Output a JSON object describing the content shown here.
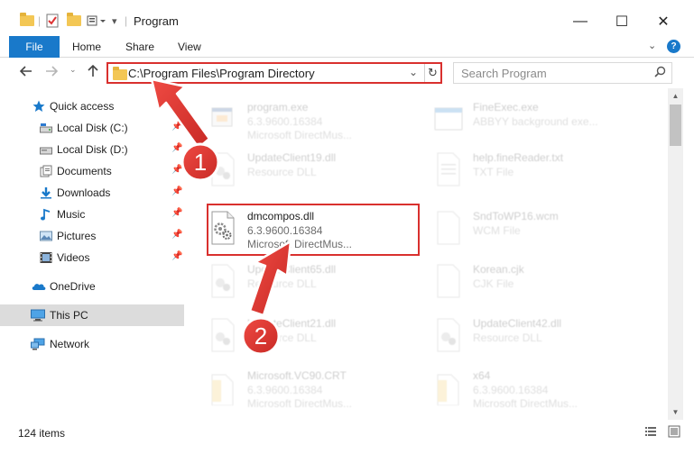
{
  "window": {
    "title": "Program",
    "minimize": "—",
    "maximize": "☐",
    "close": "✕"
  },
  "ribbon": {
    "tabs": [
      "File",
      "Home",
      "Share",
      "View"
    ],
    "help": "?"
  },
  "address": {
    "path": "C:\\Program Files\\Program Directory",
    "search_placeholder": "Search Program"
  },
  "sidebar": {
    "items": [
      {
        "label": "Quick access",
        "icon": "star-icon",
        "pinned": false
      },
      {
        "label": "Local Disk (C:)",
        "icon": "drive-icon",
        "pinned": true
      },
      {
        "label": "Local Disk (D:)",
        "icon": "drive-icon",
        "pinned": true
      },
      {
        "label": "Documents",
        "icon": "documents-icon",
        "pinned": true
      },
      {
        "label": "Downloads",
        "icon": "download-icon",
        "pinned": true
      },
      {
        "label": "Music",
        "icon": "music-icon",
        "pinned": true
      },
      {
        "label": "Pictures",
        "icon": "pictures-icon",
        "pinned": true
      },
      {
        "label": "Videos",
        "icon": "videos-icon",
        "pinned": true
      },
      {
        "label": "OneDrive",
        "icon": "cloud-icon",
        "pinned": false
      },
      {
        "label": "This PC",
        "icon": "computer-icon",
        "pinned": false,
        "selected": true
      },
      {
        "label": "Network",
        "icon": "network-icon",
        "pinned": false
      }
    ]
  },
  "files": {
    "left": [
      {
        "name": "program.exe",
        "line2": "6.3.9600.16384",
        "line3": "Microsoft DirectMus...",
        "icon": "exe-icon",
        "faded": true
      },
      {
        "name": "UpdateClient19.dll",
        "line2": "Resource DLL",
        "line3": "",
        "icon": "dll-icon",
        "faded": true
      },
      {
        "name": "dmcompos.dll",
        "line2": "6.3.9600.16384",
        "line3": "Microsoft DirectMus...",
        "icon": "dll-icon",
        "faded": false
      },
      {
        "name": "UpdateClient65.dll",
        "line2": "Resource DLL",
        "line3": "",
        "icon": "dll-icon",
        "faded": true
      },
      {
        "name": "UpdateClient21.dll",
        "line2": "Resource DLL",
        "line3": "",
        "icon": "dll-icon",
        "faded": true
      },
      {
        "name": "Microsoft.VC90.CRT",
        "line2": "6.3.9600.16384",
        "line3": "Microsoft DirectMus...",
        "icon": "folder-file-icon",
        "faded": true
      }
    ],
    "right": [
      {
        "name": "FineExec.exe",
        "line2": "ABBYY background exe...",
        "line3": "",
        "icon": "window-icon",
        "faded": true
      },
      {
        "name": "help.fineReader.txt",
        "line2": "TXT File",
        "line3": "",
        "icon": "txt-icon",
        "faded": true
      },
      {
        "name": "SndToWP16.wcm",
        "line2": "WCM File",
        "line3": "",
        "icon": "blank-file-icon",
        "faded": true
      },
      {
        "name": "Korean.cjk",
        "line2": "CJK File",
        "line3": "",
        "icon": "blank-file-icon",
        "faded": true
      },
      {
        "name": "UpdateClient42.dll",
        "line2": "Resource DLL",
        "line3": "",
        "icon": "dll-icon",
        "faded": true
      },
      {
        "name": "x64",
        "line2": "6.3.9600.16384",
        "line3": "Microsoft DirectMus...",
        "icon": "folder-file-icon",
        "faded": true
      }
    ]
  },
  "annotations": {
    "step1": "1",
    "step2": "2"
  },
  "status": {
    "item_count": "124 items"
  },
  "colors": {
    "accent": "#1979ca",
    "highlight": "#d9302e",
    "selected_bg": "#dcdcdc"
  }
}
